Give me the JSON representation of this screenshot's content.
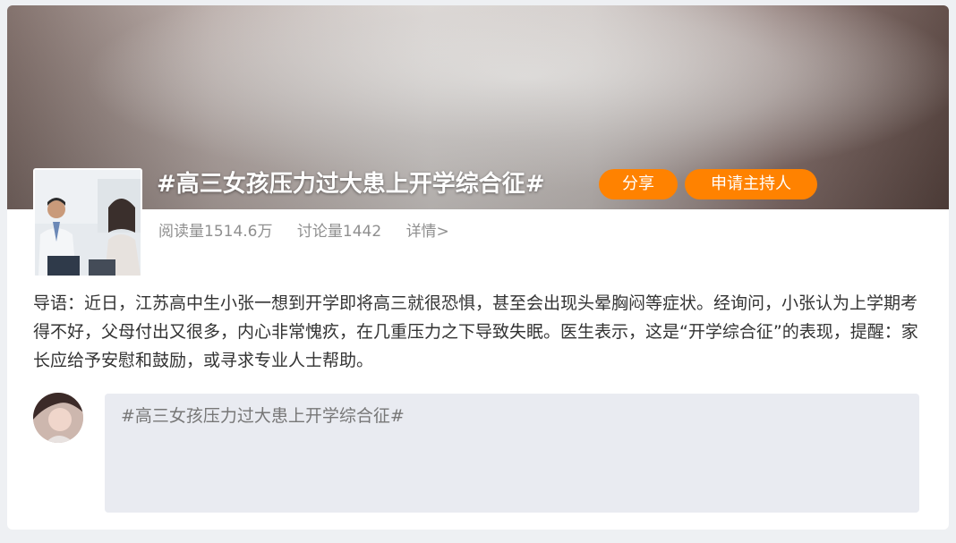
{
  "topic": {
    "title": "#高三女孩压力过大患上开学综合征#",
    "share_label": "分享",
    "apply_host_label": "申请主持人"
  },
  "stats": {
    "reads": "阅读量1514.6万",
    "discussions": "讨论量1442",
    "details_link": "详情>"
  },
  "intro": {
    "text": "导语：近日，江苏高中生小张一想到开学即将高三就很恐惧，甚至会出现头晕胸闷等症状。经询问，小张认为上学期考得不好，父母付出又很多，内心非常愧疚，在几重压力之下导致失眠。医生表示，这是“开学综合征”的表现，提醒：家长应给予安慰和鼓励，或寻求专业人士帮助。"
  },
  "composer": {
    "value": "#高三女孩压力过大患上开学综合征#"
  },
  "colors": {
    "accent": "#ff8200",
    "composer_bg": "#e9ebf1",
    "text": "#333333",
    "muted": "#8f8f8f"
  }
}
